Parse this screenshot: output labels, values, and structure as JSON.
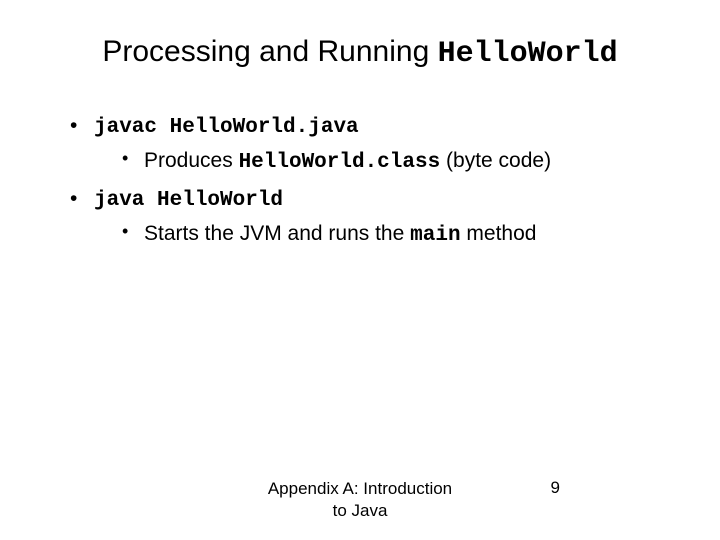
{
  "title": {
    "prefix": "Processing and Running ",
    "mono": "HelloWorld"
  },
  "bullets": [
    {
      "mono": "javac HelloWorld.java",
      "sub": {
        "pre": "Produces ",
        "mono": "HelloWorld.class",
        "post": " (byte code)"
      }
    },
    {
      "mono": "java HelloWorld",
      "sub": {
        "pre": "Starts the JVM and runs the ",
        "mono": "main",
        "post": " method"
      }
    }
  ],
  "footer": {
    "text": "Appendix A: Introduction to Java",
    "page": "9"
  }
}
